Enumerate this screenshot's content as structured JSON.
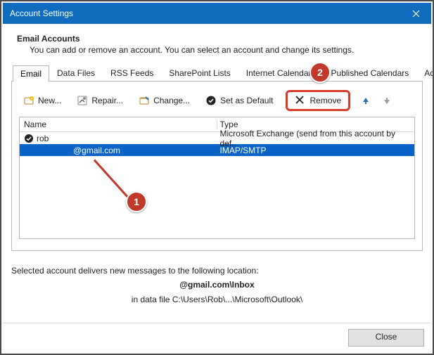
{
  "window": {
    "title": "Account Settings"
  },
  "header": {
    "title": "Email Accounts",
    "subtitle": "You can add or remove an account. You can select an account and change its settings."
  },
  "tabs": [
    {
      "label": "Email",
      "active": true
    },
    {
      "label": "Data Files"
    },
    {
      "label": "RSS Feeds"
    },
    {
      "label": "SharePoint Lists"
    },
    {
      "label": "Internet Calendars"
    },
    {
      "label": "Published Calendars"
    },
    {
      "label": "Address Books"
    }
  ],
  "toolbar": {
    "new": "New...",
    "repair": "Repair...",
    "change": "Change...",
    "default": "Set as Default",
    "remove": "Remove"
  },
  "columns": {
    "name": "Name",
    "type": "Type"
  },
  "rows": [
    {
      "name": "rob",
      "type": "Microsoft Exchange (send from this account by def...",
      "default": true,
      "selected": false
    },
    {
      "name": "@gmail.com",
      "type": "IMAP/SMTP",
      "default": false,
      "selected": true
    }
  ],
  "footer": {
    "intro": "Selected account delivers new messages to the following location:",
    "location": "@gmail.com\\Inbox",
    "datafile": "in data file C:\\Users\\Rob\\...\\Microsoft\\Outlook\\"
  },
  "buttons": {
    "close": "Close"
  },
  "annotations": {
    "b1": "1",
    "b2": "2"
  }
}
